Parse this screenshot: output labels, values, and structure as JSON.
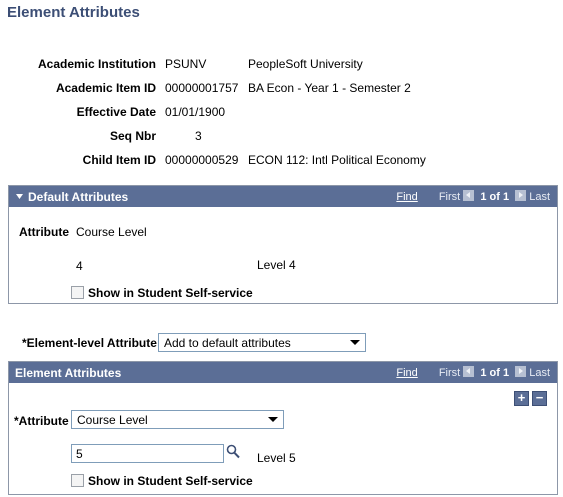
{
  "page_title": "Element Attributes",
  "header_fields": [
    {
      "label": "Academic Institution",
      "code": "PSUNV",
      "desc": "PeopleSoft University"
    },
    {
      "label": "Academic Item ID",
      "code": "00000001757",
      "desc": "BA Econ - Year 1 - Semester 2"
    },
    {
      "label": "Effective Date",
      "code": "01/01/1900",
      "desc": ""
    },
    {
      "label": "Seq Nbr",
      "code": "3",
      "desc": ""
    },
    {
      "label": "Child Item ID",
      "code": "00000000529",
      "desc": "ECON  112: Intl Political Economy"
    }
  ],
  "default_attributes": {
    "title": "Default Attributes",
    "nav": {
      "find": "Find",
      "first": "First",
      "range": "1 of 1",
      "last": "Last"
    },
    "attribute_label": "Attribute",
    "attribute_value": "Course Level",
    "value_code": "4",
    "value_desc": "Level 4",
    "self_service_label": "Show in Student Self-service"
  },
  "element_level": {
    "label": "*Element-level Attribute",
    "selected": "Add to default attributes"
  },
  "element_attributes": {
    "title": "Element Attributes",
    "nav": {
      "find": "Find",
      "first": "First",
      "range": "1 of 1",
      "last": "Last"
    },
    "add_symbol": "+",
    "remove_symbol": "−",
    "attribute_label": "*Attribute",
    "attribute_selected": "Course Level",
    "value_input": "5",
    "value_desc": "Level 5",
    "self_service_label": "Show in Student Self-service"
  },
  "icons": {
    "lookup": "magnifier-icon",
    "collapse": "triangle-down-icon",
    "prev": "prev-arrow-icon",
    "next": "next-arrow-icon"
  }
}
